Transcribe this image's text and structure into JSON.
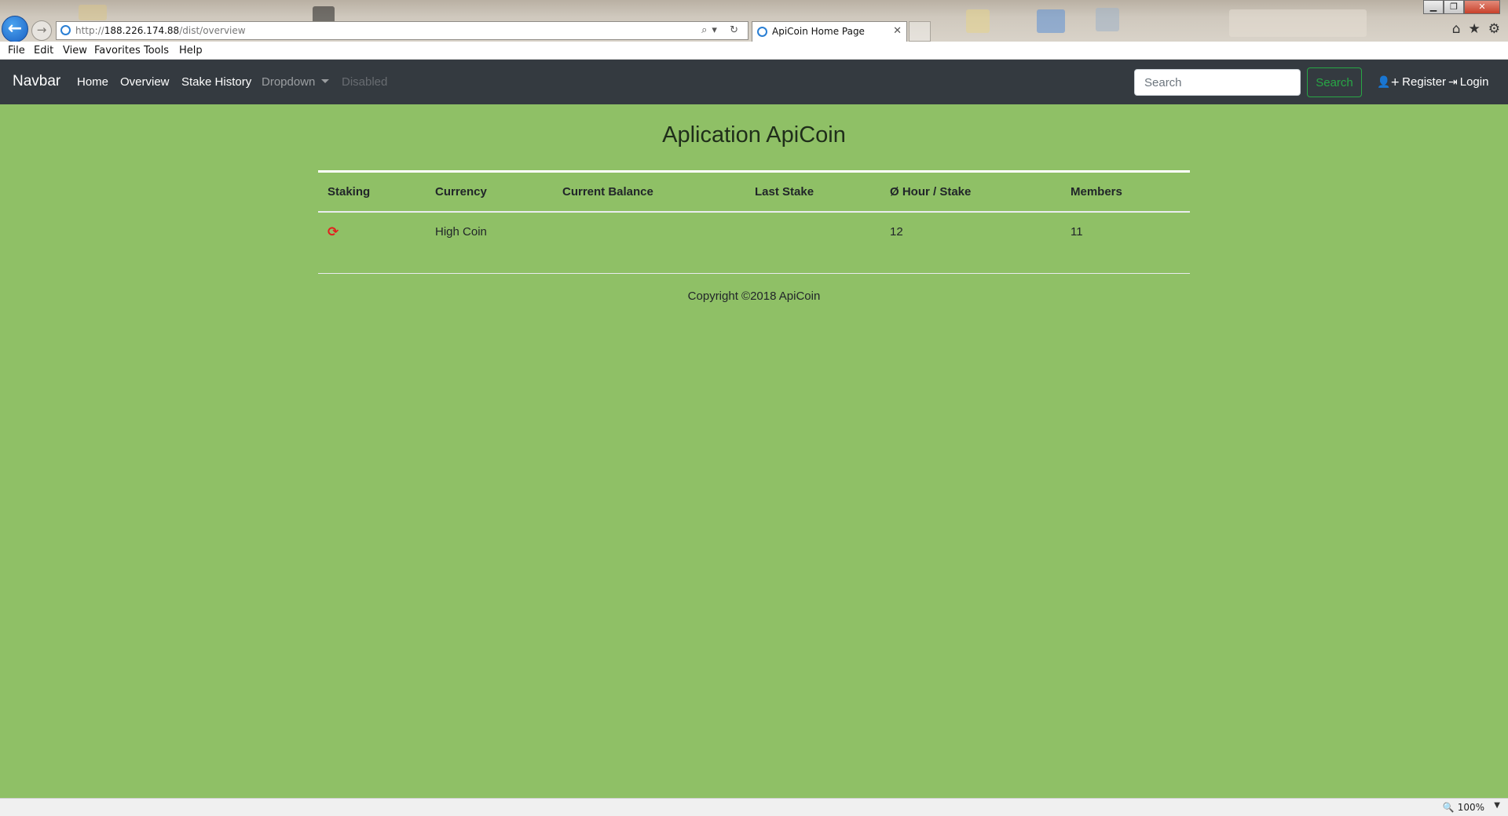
{
  "browser": {
    "url_prefix": "http://",
    "url_host": "188.226.174.88",
    "url_path": "/dist/overview",
    "tab_title": "ApiCoin Home Page",
    "tab_close": "✕",
    "back_glyph": "←",
    "forward_glyph": "→",
    "address_tools": "⌕▾ ↻",
    "window_buttons": [
      "▁",
      "❐",
      "✕"
    ],
    "toolbar_icons": [
      {
        "name": "home-icon",
        "glyph": "⌂"
      },
      {
        "name": "star-icon",
        "glyph": "★"
      },
      {
        "name": "gear-icon",
        "glyph": "⚙"
      }
    ],
    "menu": [
      "File",
      "Edit",
      "View",
      "Favorites",
      "Tools",
      "Help"
    ],
    "zoom": "100%",
    "zoom_arrow": "▼"
  },
  "navbar": {
    "brand": "Navbar",
    "links": {
      "home": "Home",
      "overview": "Overview",
      "stake_history": "Stake History",
      "dropdown": "Dropdown",
      "disabled": "Disabled"
    },
    "search_placeholder": "Search",
    "search_button": "Search",
    "register": "Register",
    "login": "Login",
    "register_icon": "👤+",
    "login_icon": "⇥"
  },
  "main": {
    "title": "Aplication ApiCoin",
    "table": {
      "headers": {
        "staking": "Staking",
        "currency": "Currency",
        "current_balance": "Current Balance",
        "last_stake": "Last Stake",
        "hour_stake": "Ø Hour / Stake",
        "members": "Members"
      },
      "rows": [
        {
          "staking_icon": "refresh-icon",
          "staking_glyph": "⟳",
          "currency": "High Coin",
          "current_balance": "",
          "last_stake": "",
          "hour_stake": "12",
          "members": "11"
        }
      ]
    },
    "copyright": "Copyright ©2018 ApiCoin"
  },
  "colors": {
    "page_background": "#8fc066",
    "navbar_background": "#343a40",
    "search_button": "#28a745",
    "staking_icon": "#e31e1e"
  }
}
